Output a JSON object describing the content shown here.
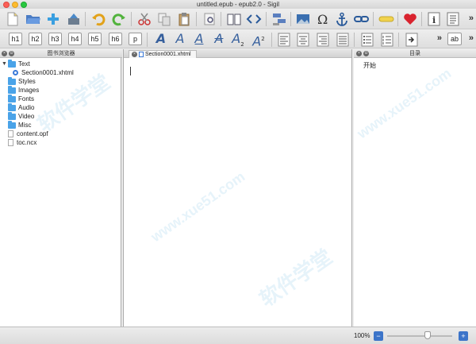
{
  "window": {
    "title": "untitled.epub - epub2.0 - Sigil"
  },
  "toolbar_main": {
    "icons": [
      "new-file-icon",
      "open-folder-icon",
      "add-existing-icon",
      "save-icon",
      "undo-icon",
      "redo-icon",
      "cut-icon",
      "copy-icon",
      "paste-icon",
      "preview-icon",
      "book-view-icon",
      "code-view-icon",
      "split-icon",
      "image-icon",
      "omega-icon",
      "anchor-icon",
      "link-icon",
      "insert-icon",
      "heart-icon",
      "info-icon",
      "list-view-icon"
    ],
    "more_glyph": "»"
  },
  "toolbar_format": {
    "headings": [
      "h1",
      "h2",
      "h3",
      "h4",
      "h5",
      "h6",
      "p"
    ],
    "font_glyph": "A",
    "subscript": "2",
    "superscript": "2",
    "more_glyph": "»",
    "ab_label": "ab"
  },
  "left_panel": {
    "title": "图书浏览器",
    "items": [
      {
        "label": "Text",
        "kind": "folder",
        "expanded": true
      },
      {
        "label": "Section0001.xhtml",
        "kind": "xhtml"
      },
      {
        "label": "Styles",
        "kind": "folder"
      },
      {
        "label": "Images",
        "kind": "folder"
      },
      {
        "label": "Fonts",
        "kind": "folder"
      },
      {
        "label": "Audio",
        "kind": "folder"
      },
      {
        "label": "Video",
        "kind": "folder"
      },
      {
        "label": "Misc",
        "kind": "folder"
      },
      {
        "label": "content.opf",
        "kind": "file"
      },
      {
        "label": "toc.ncx",
        "kind": "file"
      }
    ]
  },
  "editor": {
    "tab_label": "Section0001.xhtml"
  },
  "right_panel": {
    "title": "目录",
    "items": [
      "开始"
    ]
  },
  "watermark": {
    "text": "软件学堂",
    "url_text": "www.xue51.com"
  },
  "statusbar": {
    "zoom_label": "100%",
    "zoom_minus": "−",
    "zoom_plus": "+",
    "zoom_level_fraction": 0.5
  },
  "colors": {
    "accent": "#3c74c9",
    "folder": "#4aa3e8",
    "font_icon": "#37609d"
  }
}
